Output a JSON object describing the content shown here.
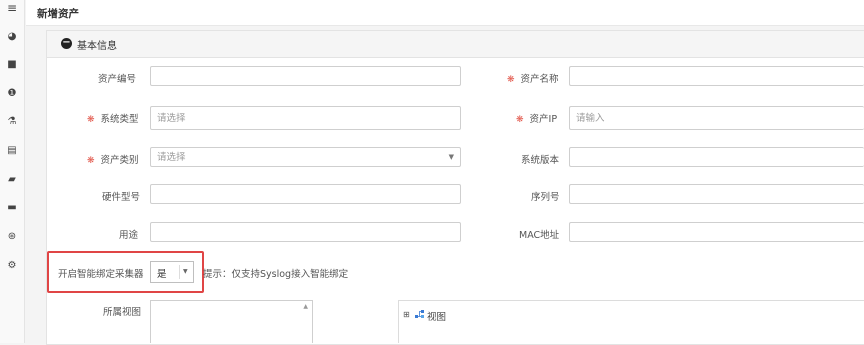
{
  "sidebar": {
    "items": [
      {
        "icon": "menu-icon",
        "glyph": "≡"
      },
      {
        "icon": "dashboard-icon",
        "glyph": "◕"
      },
      {
        "icon": "video-icon",
        "glyph": "■"
      },
      {
        "icon": "info-icon",
        "glyph": "❶"
      },
      {
        "icon": "flask-icon",
        "glyph": "⚗"
      },
      {
        "icon": "document-icon",
        "glyph": "▤"
      },
      {
        "icon": "book-icon",
        "glyph": "▰"
      },
      {
        "icon": "briefcase-icon",
        "glyph": "▬"
      },
      {
        "icon": "gauge-icon",
        "glyph": "⊛"
      },
      {
        "icon": "cogs-icon",
        "glyph": "⚙"
      }
    ]
  },
  "page": {
    "title": "新增资产"
  },
  "section": {
    "title": "基本信息",
    "collapse_icon": "minus-circle-icon"
  },
  "form": {
    "required_marker": "❋",
    "asset_number": {
      "label": "资产编号",
      "value": ""
    },
    "asset_name": {
      "label": "资产名称",
      "value": ""
    },
    "system_type": {
      "label": "系统类型",
      "placeholder": "请选择"
    },
    "asset_ip": {
      "label": "资产IP",
      "placeholder": "请输入"
    },
    "asset_category": {
      "label": "资产类别",
      "placeholder": "请选择"
    },
    "system_version": {
      "label": "系统版本",
      "value": ""
    },
    "hardware_model": {
      "label": "硬件型号",
      "value": ""
    },
    "serial_number": {
      "label": "序列号",
      "value": ""
    },
    "purpose": {
      "label": "用途",
      "value": ""
    },
    "mac_address": {
      "label": "MAC地址",
      "value": ""
    },
    "smart_binding": {
      "label": "开启智能绑定采集器",
      "selected": "是",
      "hint": "提示：仅支持Syslog接入智能绑定"
    },
    "view": {
      "label": "所属视图",
      "tree_root": "视图"
    }
  },
  "colors": {
    "required": "#e2564a",
    "highlight_border": "#e04545"
  }
}
